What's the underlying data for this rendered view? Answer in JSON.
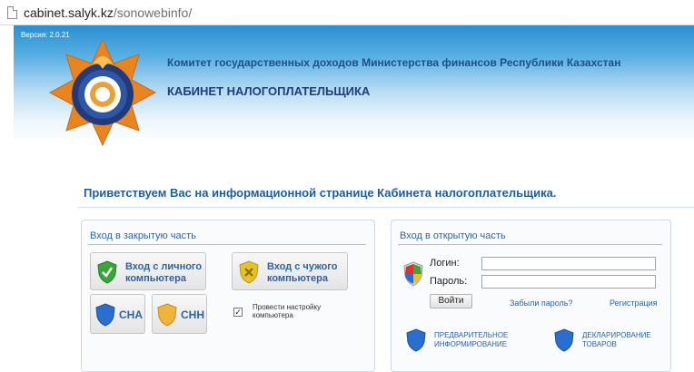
{
  "browser": {
    "url_host": "cabinet.salyk.kz",
    "url_path": "/sonowebinfo/"
  },
  "header": {
    "version": "Версия: 2.0.21",
    "org": "Комитет государственных доходов Министерства финансов Республики Казахстан",
    "cabinet": "КАБИНЕТ НАЛОГОПЛАТЕЛЬЩИКА"
  },
  "welcome": "Приветствуем Вас на информационной странице Кабинета налогоплательщика.",
  "closed": {
    "title": "Вход в закрытую часть",
    "personal_line1": "Вход с личного",
    "personal_line2": "компьютера",
    "foreign_line1": "Вход с чужого",
    "foreign_line2": "компьютера",
    "cha": "СНА",
    "chh": "СНН",
    "setup_line1": "Провести настройку",
    "setup_line2": "компьютера",
    "setup_checked": true
  },
  "open": {
    "title": "Вход в открытую часть",
    "login_label": "Логин:",
    "password_label": "Пароль:",
    "login_value": "",
    "password_value": "",
    "login_button": "Войти",
    "forgot": "Забыли пароль?",
    "register": "Регистрация",
    "prelim_line1": "ПРЕДВАРИТЕЛЬНОЕ",
    "prelim_line2": "ИНФОРМИРОВАНИЕ",
    "decl_line1": "ДЕКЛАРИРОВАНИЕ",
    "decl_line2": "ТОВАРОВ"
  },
  "colors": {
    "accent": "#2e63a3",
    "shield_blue": "#2a6fd0",
    "shield_green": "#3aa63a",
    "shield_yellow": "#e6c229",
    "emblem_orange": "#e9851f",
    "emblem_navy": "#233a7a"
  },
  "icons": [
    "page-icon",
    "emblem-logo",
    "green-shield-icon",
    "yellow-shield-icon",
    "blue-shield-icon",
    "orange-shield-icon",
    "windows-shield-icon"
  ]
}
